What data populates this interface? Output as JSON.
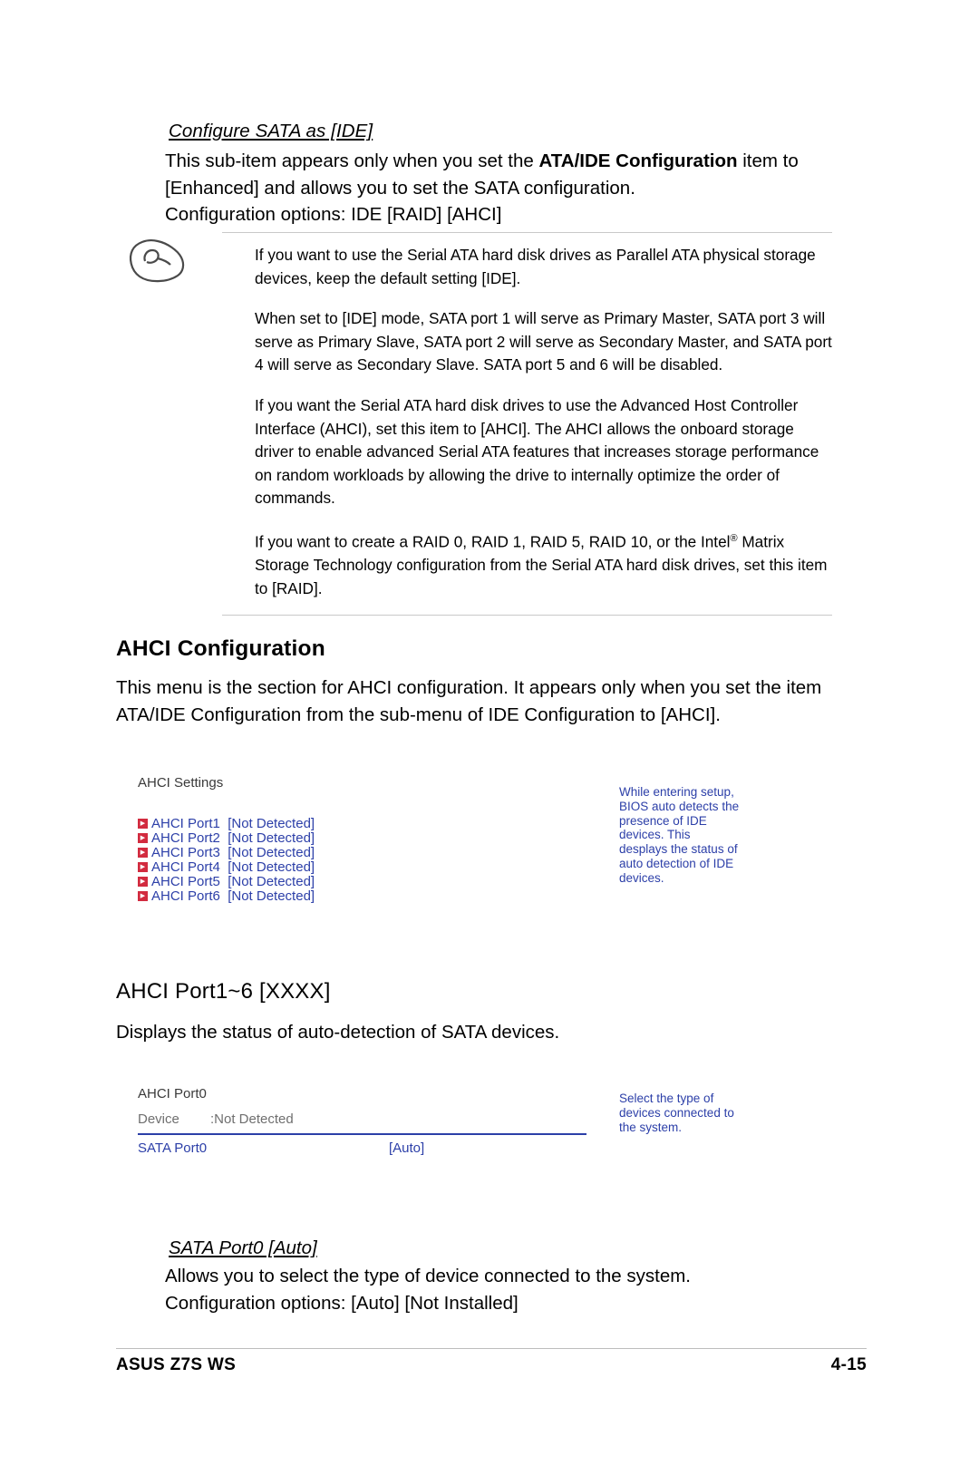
{
  "section_top": {
    "subhead": "Configure SATA as [IDE]",
    "body_lines": [
      "This sub-item appears only when you set the ",
      "ATA/IDE Configuration",
      " item to [Enhanced] and allows you to set the SATA configuration.",
      "Configuration options: IDE [RAID] [AHCI]"
    ],
    "body_part1": "This sub-item appears only when you set the ",
    "body_bold": "ATA/IDE Configuration",
    "body_part2": " item to [Enhanced] and allows you to set the SATA configuration.",
    "body_part3": "Configuration options: IDE [RAID] [AHCI]"
  },
  "note": {
    "icon_name": "pointing-hand-note-icon",
    "paragraphs": [
      "If you want to use the Serial ATA hard disk drives as Parallel ATA physical storage devices, keep the default setting [IDE].",
      "When set to [IDE] mode, SATA port 1 will serve as Primary Master, SATA port 3 will serve as Primary Slave, SATA port 2 will serve as Secondary Master, and SATA port 4 will serve as Secondary Slave. SATA port 5 and 6 will be disabled.",
      "If you want the Serial ATA hard disk drives to use the Advanced Host Controller Interface (AHCI), set this item to [AHCI]. The AHCI allows the onboard storage driver to enable advanced Serial ATA features that increases storage performance on random workloads by allowing the drive to internally optimize the order of commands."
    ],
    "paragraph4_part1": "If you want to create a RAID 0, RAID 1, RAID 5, RAID 10, or the Intel",
    "paragraph4_sup": "®",
    "paragraph4_part2": " Matrix Storage Technology configuration from the Serial ATA hard disk drives, set this item to [RAID]."
  },
  "ahci_config": {
    "heading": "AHCI Configuration",
    "body": "This menu is the section for AHCI configuration. It appears only when you set the item ATA/IDE Configuration from the sub-menu of IDE Configuration to [AHCI]."
  },
  "bios_screen_1": {
    "title": "AHCI Settings",
    "rows": [
      {
        "label": "AHCI Port1  [Not Detected]"
      },
      {
        "label": "AHCI Port2  [Not Detected]"
      },
      {
        "label": "AHCI Port3  [Not Detected]"
      },
      {
        "label": "AHCI Port4  [Not Detected]"
      },
      {
        "label": "AHCI Port5  [Not Detected]"
      },
      {
        "label": "AHCI Port6  [Not Detected]"
      }
    ],
    "help_text": "While entering setup, BIOS auto detects the presence of IDE devices. This desplays the status of auto detection of IDE devices.",
    "accent_color": "#2c3fa8",
    "bullet_color": "#d22b3f"
  },
  "ahci_port": {
    "heading": "AHCI Port1~6 [XXXX]",
    "body": "Displays the status of auto-detection of SATA devices."
  },
  "bios_screen_2": {
    "title": "AHCI Port0",
    "device_label": "Device",
    "device_value": ":Not Detected",
    "sata_label": "SATA Port0",
    "sata_value": "[Auto]",
    "help_text": "Select the type of devices connected to the system.",
    "accent_color": "#2c3fa8"
  },
  "sata_port0": {
    "subhead": "SATA Port0 [Auto]",
    "body_line1": "Allows you to select the type of device connected to the system.",
    "body_line2": "Configuration options: [Auto] [Not Installed]"
  },
  "footer": {
    "left": "ASUS Z7S WS",
    "right": "4-15"
  }
}
